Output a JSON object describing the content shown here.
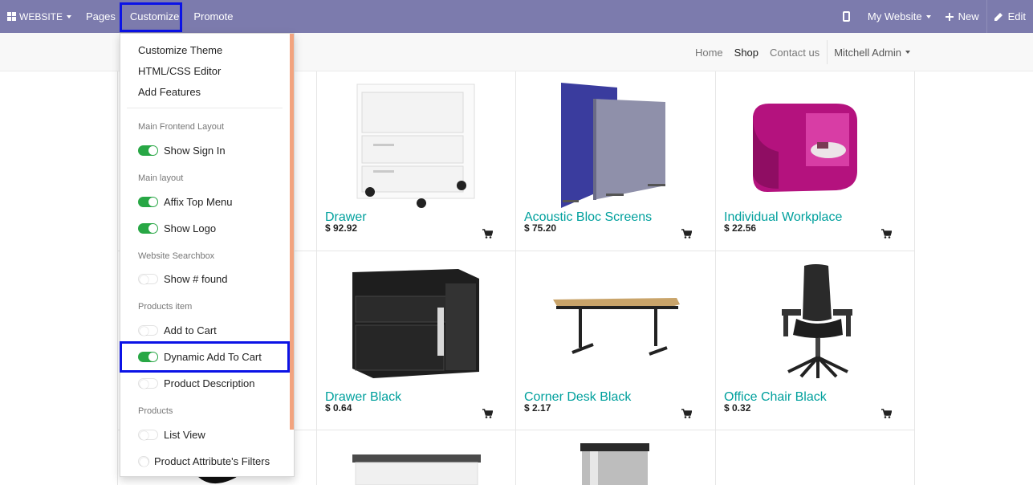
{
  "topbar": {
    "brand": "WEBSITE",
    "menu": [
      "Pages",
      "Customize",
      "Promote"
    ],
    "website_selector": "My Website",
    "new_label": "New",
    "edit_label": "Edit"
  },
  "site_nav": {
    "links": [
      "Home",
      "Shop",
      "Contact us"
    ],
    "user": "Mitchell Admin"
  },
  "customize_menu": {
    "items": [
      "Customize Theme",
      "HTML/CSS Editor",
      "Add Features"
    ],
    "sections": [
      {
        "header": "Main Frontend Layout",
        "options": [
          {
            "label": "Show Sign In",
            "on": true
          }
        ]
      },
      {
        "header": "Main layout",
        "options": [
          {
            "label": "Affix Top Menu",
            "on": true
          },
          {
            "label": "Show Logo",
            "on": true
          }
        ]
      },
      {
        "header": "Website Searchbox",
        "options": [
          {
            "label": "Show # found",
            "on": false
          }
        ]
      },
      {
        "header": "Products item",
        "options": [
          {
            "label": "Add to Cart",
            "on": false
          },
          {
            "label": "Dynamic Add To Cart",
            "on": true
          },
          {
            "label": "Product Description",
            "on": false
          }
        ]
      },
      {
        "header": "Products",
        "options": [
          {
            "label": "List View",
            "on": false
          },
          {
            "label": "Product Attribute's Filters",
            "on": false
          }
        ]
      }
    ]
  },
  "products": [
    {
      "name": "Drawer",
      "price": "$ 92.92",
      "image": "white-drawer-unit"
    },
    {
      "name": "Acoustic Bloc Screens",
      "price": "$ 75.20",
      "image": "acoustic-screens"
    },
    {
      "name": "Individual Workplace",
      "price": "$ 22.56",
      "image": "pink-pod-workplace"
    },
    {
      "name": "Drawer Black",
      "price": "$ 0.64",
      "image": "black-drawer-unit"
    },
    {
      "name": "Corner Desk Black",
      "price": "$ 2.17",
      "image": "corner-desk"
    },
    {
      "name": "Office Chair Black",
      "price": "$ 0.32",
      "image": "office-chair"
    }
  ],
  "colors": {
    "topbar": "#7c7bad",
    "accent": "#00a09d",
    "toggle_on": "#28a745",
    "highlight": "#0b13e6"
  }
}
